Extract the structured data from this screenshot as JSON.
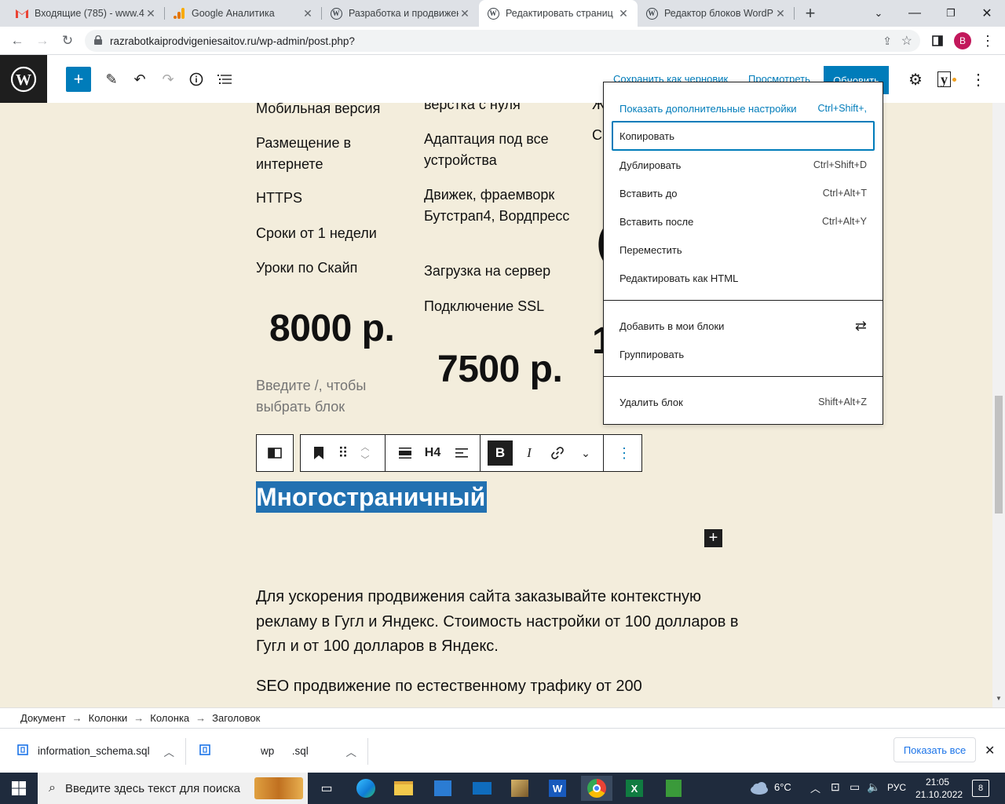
{
  "browser": {
    "tabs": [
      {
        "title": "Входящие (785) - www.46",
        "icon": "gmail-icon"
      },
      {
        "title": "Google Аналитика",
        "icon": "analytics-icon"
      },
      {
        "title": "Разработка и продвижен",
        "icon": "wordpress-icon"
      },
      {
        "title": "Редактировать страниц",
        "icon": "wordpress-icon"
      },
      {
        "title": "Редактор блоков WordP",
        "icon": "wordpress-icon"
      }
    ],
    "active_tab": 3,
    "url": "razrabotkaiprodvigeniesaitov.ru/wp-admin/post.php?",
    "profile_initial": "B"
  },
  "wp_header": {
    "save_draft": "Сохранить как черновик",
    "preview": "Просмотреть",
    "update": "Обновить",
    "yoast_letter": "y"
  },
  "content": {
    "col1": {
      "items": [
        "Мобильная версия",
        "Размещение в интернете",
        "HTTPS",
        "Сроки от 1 недели",
        "Уроки по Скайп"
      ],
      "price": "8000 р.",
      "placeholder": "Введите /, чтобы выбрать блок"
    },
    "col2": {
      "items": [
        "верстка с нуля",
        "Адаптация под все устройства",
        "Движек, фраемворк Бутстрап4, Вордпресс",
        "Загрузка на сервер",
        "Подключение SSL"
      ],
      "price": "7500 р."
    },
    "col3_partial": [
      "Ж",
      "С",
      "(",
      "1"
    ],
    "heading": "Многостраничный",
    "paragraph1": "Для ускорения продвижения сайта заказывайте контекстную рекламу в Гугл и Яндекс. Стоимость настройки от 100 долларов в Гугл и от 100 долларов в Яндекс.",
    "paragraph2": "SEO продвижение по естественному трафику от 200"
  },
  "block_toolbar": {
    "heading_level": "H4",
    "bold": "B",
    "italic": "I"
  },
  "menu": {
    "items": [
      {
        "label": "Показать дополнительные настройки",
        "shortcut": "Ctrl+Shift+,"
      },
      {
        "label": "Копировать",
        "shortcut": ""
      },
      {
        "label": "Дублировать",
        "shortcut": "Ctrl+Shift+D"
      },
      {
        "label": "Вставить до",
        "shortcut": "Ctrl+Alt+T"
      },
      {
        "label": "Вставить после",
        "shortcut": "Ctrl+Alt+Y"
      },
      {
        "label": "Переместить",
        "shortcut": ""
      },
      {
        "label": "Редактировать как HTML",
        "shortcut": ""
      }
    ],
    "section2": [
      {
        "label": "Добавить в мои блоки",
        "shortcut": ""
      },
      {
        "label": "Группировать",
        "shortcut": ""
      }
    ],
    "section3": [
      {
        "label": "Удалить блок",
        "shortcut": "Shift+Alt+Z"
      }
    ]
  },
  "breadcrumb": [
    "Документ",
    "Колонки",
    "Колонка",
    "Заголовок"
  ],
  "breadcrumb_arrow": "→",
  "downloads": {
    "files": [
      "information_schema.sql",
      "wp      .sql"
    ],
    "show_all": "Показать все"
  },
  "taskbar": {
    "search_placeholder": "Введите здесь текст для поиска",
    "temperature": "6°C",
    "language": "РУС",
    "time": "21:05",
    "date": "21.10.2022",
    "notifications": "8"
  },
  "colors": {
    "wp_blue": "#007cba",
    "canvas_bg": "#f3eddc",
    "selection": "#2271b1"
  }
}
